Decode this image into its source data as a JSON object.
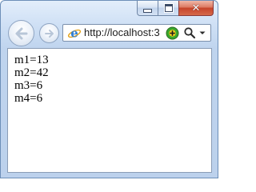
{
  "window": {
    "caption_buttons": {
      "minimize_icon": "minimize-icon",
      "maximize_icon": "maximize-icon",
      "close_icon": "close-icon",
      "close_glyph": "✕"
    }
  },
  "toolbar": {
    "back_icon": "back-arrow-icon",
    "forward_icon": "forward-arrow-icon",
    "address": {
      "url": "http://localhost:3",
      "browser_icon": "ie-logo-icon",
      "compat_icon": "compatibility-view-icon",
      "search_icon": "search-icon",
      "dropdown_icon": "chevron-down-icon"
    }
  },
  "content": {
    "lines": [
      "m1=13",
      "m2=42",
      "m3=6",
      "m4=6"
    ]
  },
  "colors": {
    "frame": "#bcd1ec",
    "close_button": "#c6442a",
    "compat_green": "#3aa82c",
    "compat_yellow": "#f2d01a",
    "ie_blue": "#2f7fd4"
  }
}
